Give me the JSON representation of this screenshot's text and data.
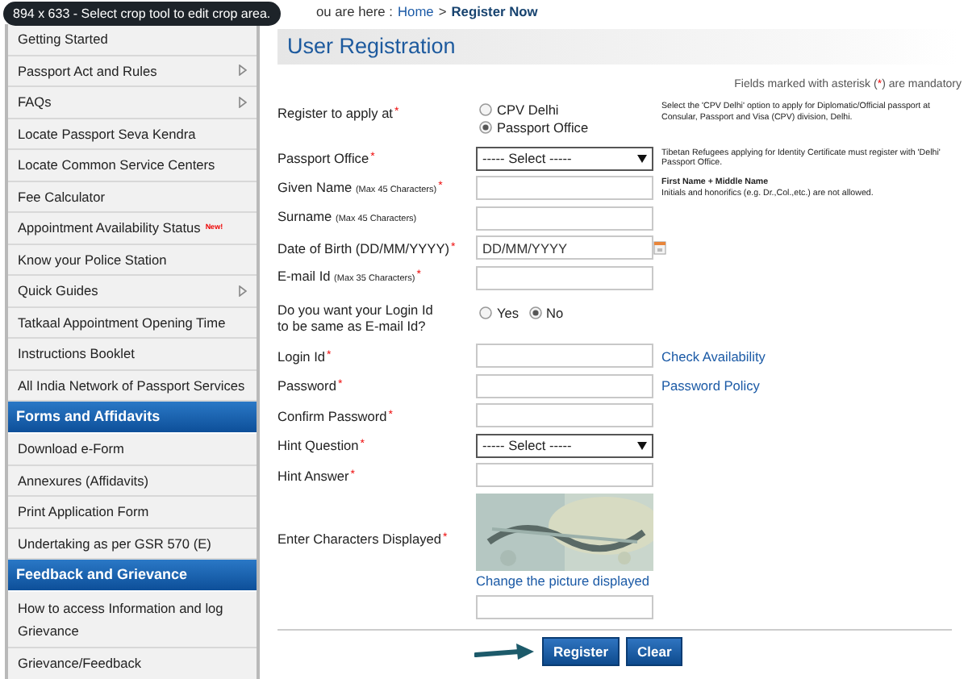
{
  "overlay_tooltip": "894 x 633 - Select crop tool to edit crop area.",
  "sidebar": {
    "items": [
      {
        "kind": "link",
        "label": "Getting Started",
        "submenu": false
      },
      {
        "kind": "link",
        "label": "Passport Act and Rules",
        "submenu": true
      },
      {
        "kind": "link",
        "label": "FAQs",
        "submenu": true
      },
      {
        "kind": "link",
        "label": "Locate Passport Seva Kendra",
        "submenu": false
      },
      {
        "kind": "link",
        "label": "Locate Common Service Centers",
        "submenu": false
      },
      {
        "kind": "link",
        "label": "Fee Calculator",
        "submenu": false
      },
      {
        "kind": "link",
        "label": "Appointment Availability Status",
        "submenu": false,
        "badge": "New!"
      },
      {
        "kind": "link",
        "label": "Know your Police Station",
        "submenu": false
      },
      {
        "kind": "link",
        "label": "Quick Guides",
        "submenu": true
      },
      {
        "kind": "link",
        "label": "Tatkaal Appointment Opening Time",
        "submenu": false
      },
      {
        "kind": "link",
        "label": "Instructions Booklet",
        "submenu": false
      },
      {
        "kind": "link",
        "label": "All India Network of Passport Services",
        "submenu": false
      },
      {
        "kind": "header",
        "label": "Forms and Affidavits"
      },
      {
        "kind": "link",
        "label": "Download e-Form",
        "submenu": false
      },
      {
        "kind": "link",
        "label": "Annexures (Affidavits)",
        "submenu": false
      },
      {
        "kind": "link",
        "label": "Print Application Form",
        "submenu": false
      },
      {
        "kind": "link",
        "label": "Undertaking as per GSR 570 (E)",
        "submenu": false
      },
      {
        "kind": "header",
        "label": "Feedback and Grievance"
      },
      {
        "kind": "link",
        "label": "How to access Information and log Grievance",
        "submenu": false
      },
      {
        "kind": "link",
        "label": "Grievance/Feedback",
        "submenu": false
      }
    ]
  },
  "breadcrumb": {
    "prefix": "ou are here :",
    "home": "Home",
    "separator": ">",
    "current": "Register Now"
  },
  "page_title": "User Registration",
  "mandatory_note": {
    "before": "Fields marked with asterisk (",
    "mark": "*",
    "after": ") are mandatory"
  },
  "form": {
    "required_mark": "*",
    "rows": [
      {
        "kind": "radio_stack",
        "label": "Register to apply at",
        "required": true,
        "options": [
          {
            "label": "CPV Delhi",
            "selected": false
          },
          {
            "label": "Passport Office",
            "selected": true
          }
        ],
        "help": "Select the 'CPV Delhi' option to apply for Diplomatic/Official passport at Consular, Passport and Visa (CPV) division, Delhi."
      },
      {
        "kind": "select",
        "label": "Passport Office",
        "required": true,
        "value": "----- Select -----",
        "help": "Tibetan Refugees applying for Identity Certificate must register with 'Delhi' Passport Office."
      },
      {
        "kind": "text",
        "label": "Given Name",
        "note": "(Max 45 Characters)",
        "required": true,
        "help_title": "First Name + Middle Name",
        "help": "Initials and honorifics (e.g. Dr.,Col.,etc.) are not allowed."
      },
      {
        "kind": "text",
        "label": "Surname",
        "note": "(Max 45 Characters)",
        "required": false
      },
      {
        "kind": "date",
        "label": "Date of Birth (DD/MM/YYYY)",
        "required": true,
        "value": "DD/MM/YYYY"
      },
      {
        "kind": "text",
        "label": "E-mail Id",
        "note": "(Max 35 Characters)",
        "required": true
      },
      {
        "kind": "radio_inline",
        "label": "Do you want your Login Id to be same as E-mail Id?",
        "required": false,
        "options": [
          {
            "label": "Yes",
            "selected": false
          },
          {
            "label": "No",
            "selected": true
          }
        ]
      },
      {
        "kind": "text",
        "label": "Login Id",
        "required": true,
        "link": "Check Availability"
      },
      {
        "kind": "text",
        "label": "Password",
        "required": true,
        "link": "Password Policy"
      },
      {
        "kind": "text",
        "label": "Confirm Password",
        "required": true
      },
      {
        "kind": "select",
        "label": "Hint Question",
        "required": true,
        "value": "----- Select -----"
      },
      {
        "kind": "text",
        "label": "Hint Answer",
        "required": true
      },
      {
        "kind": "captcha",
        "label": "Enter Characters Displayed",
        "required": true,
        "link": "Change the picture displayed"
      }
    ]
  },
  "buttons": [
    {
      "label": "Register"
    },
    {
      "label": "Clear"
    }
  ]
}
